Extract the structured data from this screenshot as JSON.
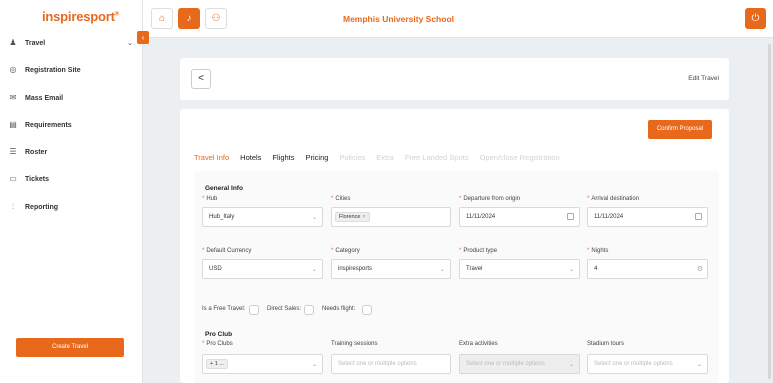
{
  "app": {
    "logo": "inspiresport",
    "logo_mark": "®",
    "page_title": "Memphis University School"
  },
  "sidebar": {
    "items": [
      {
        "label": "Travel",
        "icon": "pin-icon",
        "expandable": true
      },
      {
        "label": "Registration Site",
        "icon": "globe-icon"
      },
      {
        "label": "Mass Email",
        "icon": "mail-icon"
      },
      {
        "label": "Requirements",
        "icon": "document-icon"
      },
      {
        "label": "Roster",
        "icon": "list-icon"
      },
      {
        "label": "Tickets",
        "icon": "ticket-icon"
      },
      {
        "label": "Reporting",
        "icon": "chart-icon"
      }
    ],
    "create_button": "Create Travel"
  },
  "header": {
    "back": "<",
    "title": "Edit Travel"
  },
  "main": {
    "confirm_button": "Confirm Proposal",
    "tabs": [
      {
        "label": "Travel Info",
        "state": "active"
      },
      {
        "label": "Hotels",
        "state": "normal"
      },
      {
        "label": "Flights",
        "state": "normal"
      },
      {
        "label": "Pricing",
        "state": "normal"
      },
      {
        "label": "Policies",
        "state": "disabled"
      },
      {
        "label": "Extra",
        "state": "disabled"
      },
      {
        "label": "Free Landed Spots",
        "state": "disabled"
      },
      {
        "label": "Open/close Registration",
        "state": "disabled"
      }
    ],
    "general_info": {
      "title": "General Info",
      "hub": {
        "label": "Hub",
        "value": "Hub_Italy"
      },
      "cities": {
        "label": "Cities",
        "tag": "Florence",
        "tag_remove": "×"
      },
      "departure": {
        "label": "Departure from origin",
        "value": "11/11/2024"
      },
      "arrival": {
        "label": "Arrival destination",
        "value": "11/11/2024"
      },
      "currency": {
        "label": "Default Currency",
        "value": "USD"
      },
      "category": {
        "label": "Category",
        "value": "inspiresports"
      },
      "product_type": {
        "label": "Product type",
        "value": "Travel"
      },
      "nights": {
        "label": "Nights",
        "value": "4"
      },
      "checkboxes": {
        "free_travel": "Is a Free Travel:",
        "direct_sales": "Direct Sales:",
        "needs_flight": "Needs flight:"
      }
    },
    "pro_club": {
      "title": "Pro Club",
      "pro_clubs": {
        "label": "Pro Clubs",
        "value": "+ 1 ..."
      },
      "training": {
        "label": "Training sessions",
        "placeholder": "Select one or multiple options"
      },
      "extra": {
        "label": "Extra activities",
        "placeholder": "Select one or multiple options"
      },
      "stadium": {
        "label": "Stadium tours",
        "placeholder": "Select one or multiple options"
      }
    }
  },
  "colors": {
    "accent": "#e8691b",
    "background": "#eceff1"
  }
}
